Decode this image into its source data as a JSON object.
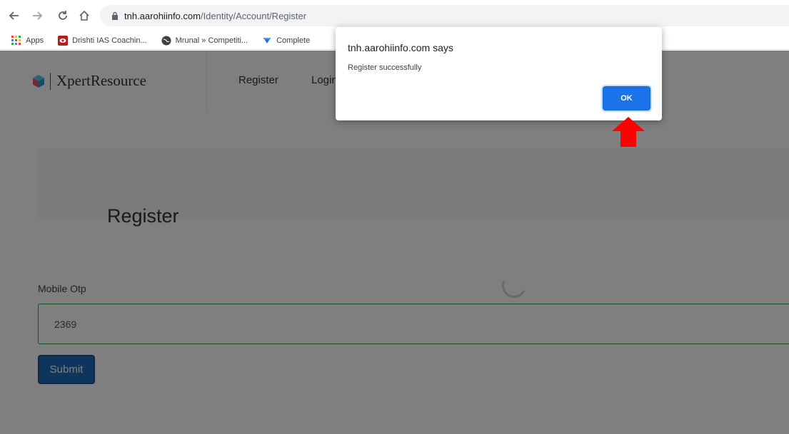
{
  "browser": {
    "url_host": "tnh.aarohiinfo.com",
    "url_path": "/Identity/Account/Register",
    "bookmarks": [
      {
        "label": "Apps",
        "icon": "apps-grid-icon"
      },
      {
        "label": "Drishti IAS Coachin...",
        "icon": "drishti-favicon"
      },
      {
        "label": "Mrunal » Competiti...",
        "icon": "globe-icon"
      },
      {
        "label": "Complete",
        "icon": "complete-favicon"
      }
    ]
  },
  "site": {
    "brand": "XpertResource",
    "nav": [
      "Register",
      "Login"
    ]
  },
  "page": {
    "title": "Register",
    "otp_label": "Mobile Otp",
    "otp_value": "2369",
    "submit_label": "Submit"
  },
  "dialog": {
    "title": "tnh.aarohiinfo.com says",
    "message": "Register successfully",
    "ok_label": "OK"
  },
  "colors": {
    "accent": "#1a73e8",
    "submit": "#1f6bb8",
    "input_border": "#28a745",
    "annotation": "#ff0000"
  }
}
